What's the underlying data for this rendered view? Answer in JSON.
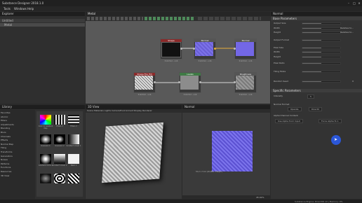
{
  "window": {
    "title": "Substance Designer 2018.1.0"
  },
  "menu": [
    "Tools",
    "Windows",
    "Help"
  ],
  "explorer": {
    "items": [
      "Untitled",
      "Metal"
    ]
  },
  "graph": {
    "tab_label": "Metal",
    "nodes": [
      {
        "title": "Shape",
        "size": "512x512 - L16"
      },
      {
        "title": "Normal",
        "size": "512x512 - L16"
      },
      {
        "title": "Normal",
        "size": "512x512 - L16"
      },
      {
        "title": "Shape Flip Hill",
        "size": "512x512 - L16"
      },
      {
        "title": "Levels",
        "size": "512x512 - L16"
      },
      {
        "title": "Roughness",
        "size": "512x512 - L16"
      }
    ]
  },
  "library": {
    "categories": [
      "Favorites",
      "Atomic",
      "Filters",
      "Adjustments",
      "Blending",
      "Blurs",
      "Channels",
      "Effects",
      "Normal Map",
      "Tiling",
      "Transforms",
      "Generators",
      "Noises",
      "Patterns",
      "Functions",
      "Resources",
      "3D View"
    ],
    "thumbs": [
      "Color to Gradient Map",
      "Filters 1",
      "Filters 2",
      "Gaussian 1",
      "Gaussian 2",
      "Gradient Linear 1",
      "Gradient Circle 1",
      "Gradient Linear 2",
      "Mesh 1"
    ]
  },
  "view3d": {
    "header": "3D View",
    "menu": [
      "Scene",
      "Materials",
      "Lights",
      "Camera",
      "Environment",
      "Display",
      "Renderer"
    ]
  },
  "view2d": {
    "header": "Normal",
    "info": "512 x 512 (RGBA, 16bpc)",
    "zoom": "45.02%"
  },
  "properties": {
    "header": "Normal",
    "sections": [
      "Base Parameters",
      "Specific Parameters"
    ],
    "rows": [
      {
        "label": "Output Size",
        "value": ""
      },
      {
        "label": "Width",
        "value": "Relative to..."
      },
      {
        "label": "Height",
        "value": "Relative to..."
      },
      {
        "label": "Output Format",
        "value": ""
      },
      {
        "label": "Pixel Size",
        "value": ""
      },
      {
        "label": "Width",
        "value": ""
      },
      {
        "label": "Height",
        "value": ""
      },
      {
        "label": "Pixel Ratio",
        "value": ""
      },
      {
        "label": "Tiling Mode",
        "value": ""
      },
      {
        "label": "Random Seed",
        "value": "0"
      }
    ],
    "specific_rows": [
      {
        "label": "Intensity",
        "value": "5"
      },
      {
        "label": "Normal Format",
        "value": "OpenGL"
      },
      {
        "label": "",
        "value": "DirectX"
      },
      {
        "label": "Alpha Channel Content",
        "value": ""
      },
      {
        "label": "",
        "value": "Use Alpha from Input"
      },
      {
        "label": "",
        "value": "Force Alpha To 1"
      }
    ]
  },
  "statusbar": {
    "text": "Substance Engine: Direct3D 10 | Memory: 0%"
  },
  "colors": {
    "accent": "#2b57d8",
    "bg": "#2b2b2b",
    "panel": "#333333"
  }
}
